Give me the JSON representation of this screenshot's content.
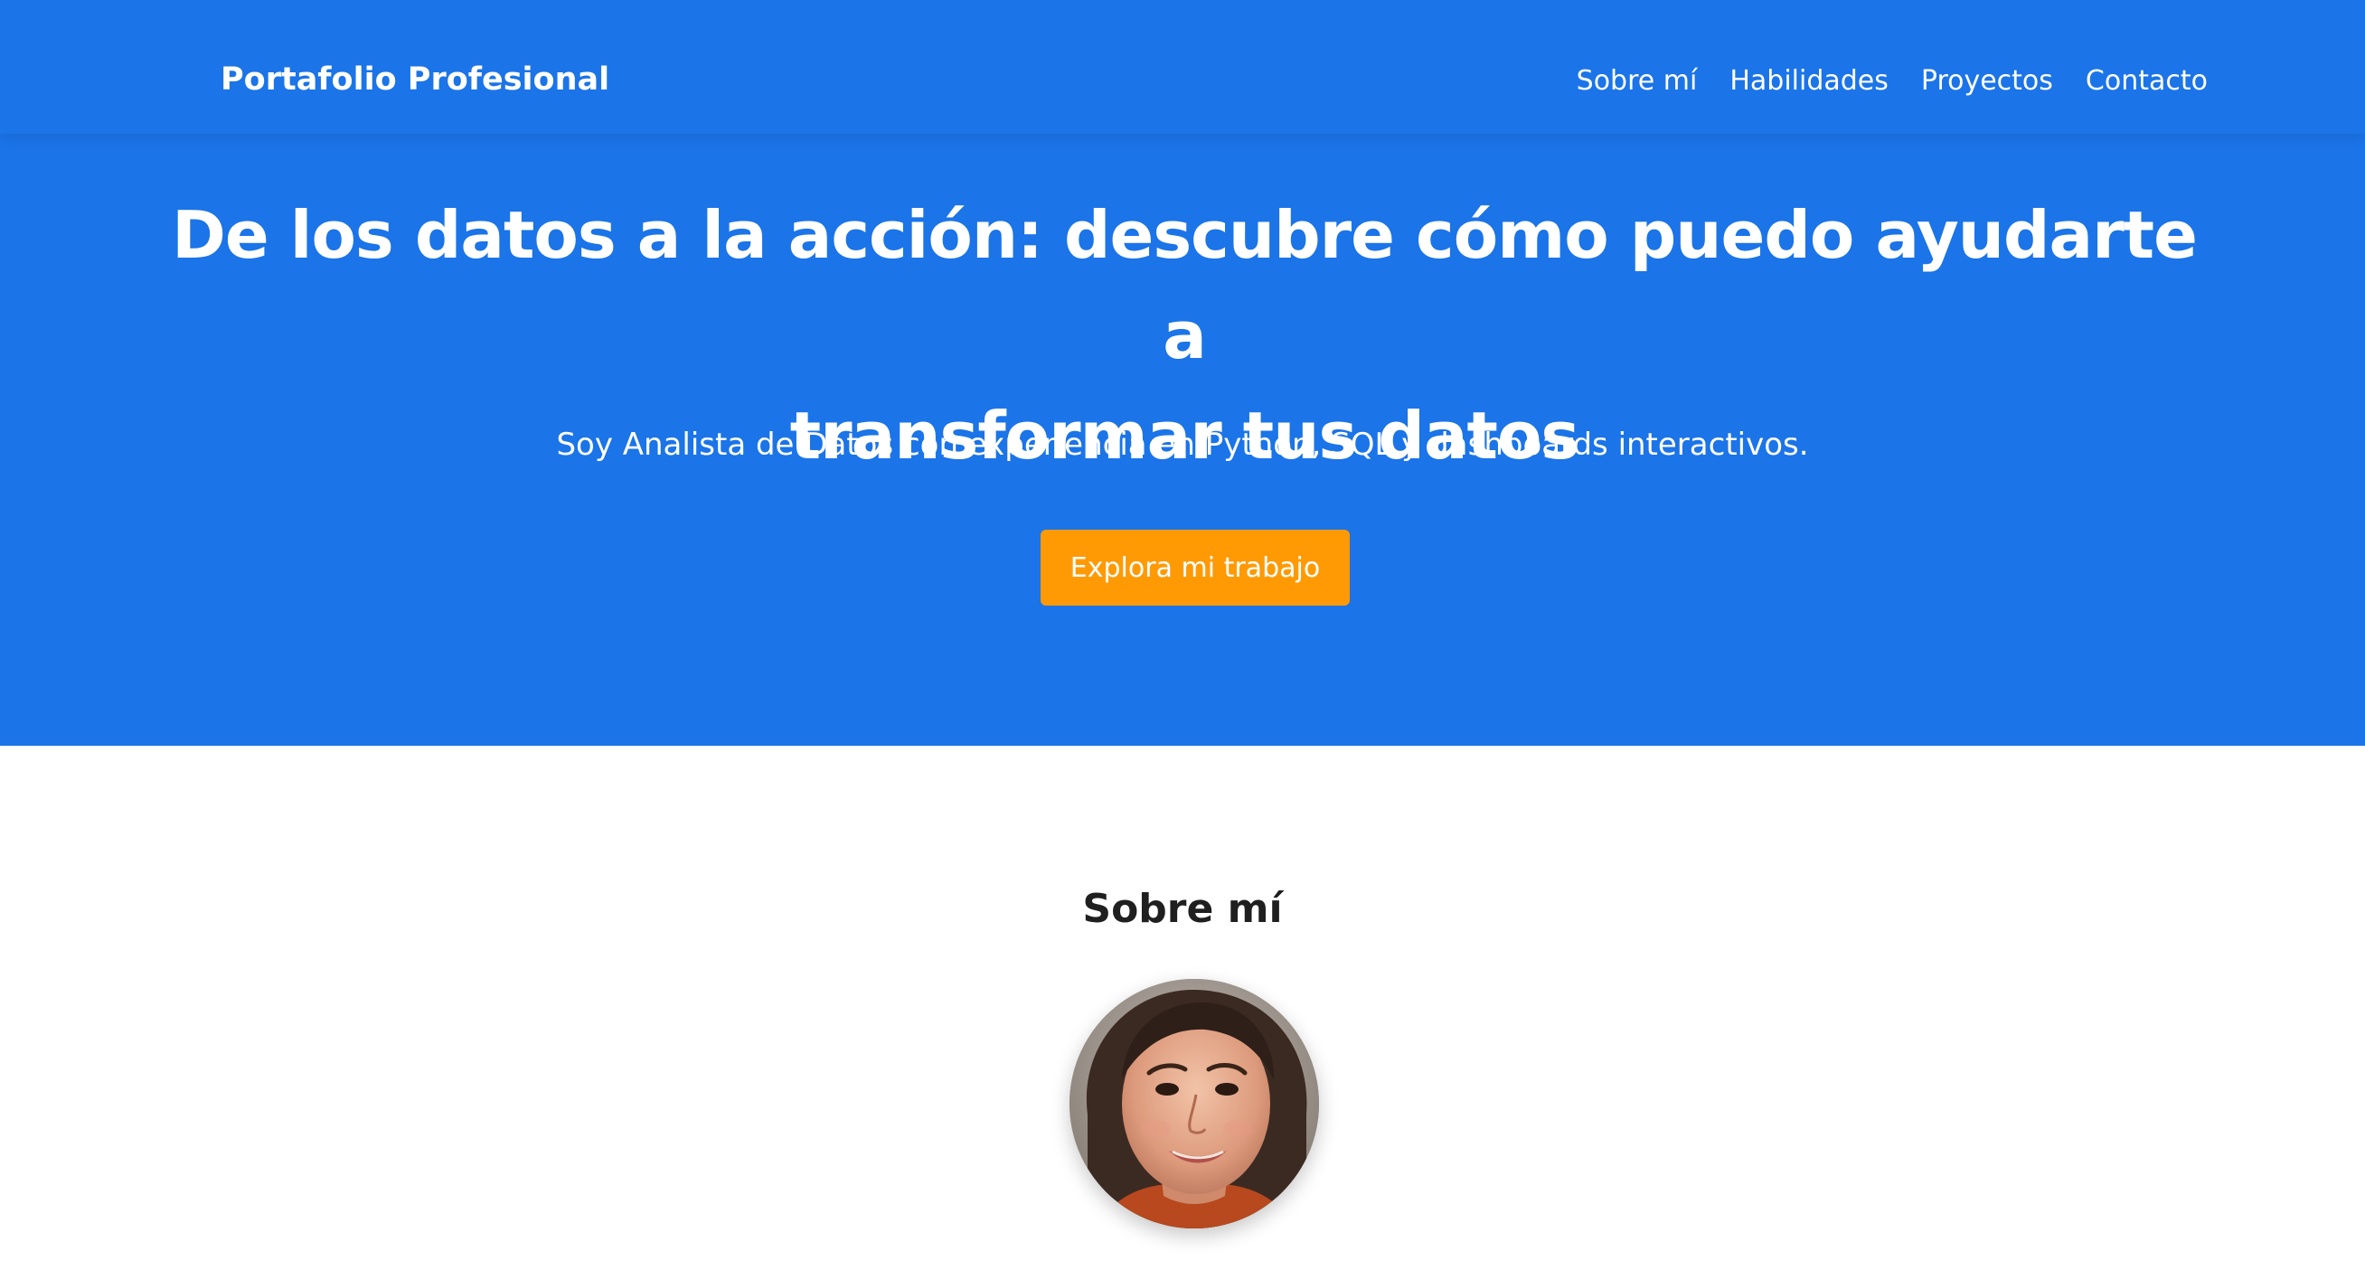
{
  "nav": {
    "brand": "Portafolio Profesional",
    "links": [
      "Sobre mí",
      "Habilidades",
      "Proyectos",
      "Contacto"
    ]
  },
  "hero": {
    "title_line1": "De los datos a la acción: descubre cómo puedo ayudarte a",
    "title_line2": "transformar tus datos",
    "subtitle": "Soy Analista de Datos con experiencia en Python, SQL y dashboards interactivos.",
    "cta_label": "Explora mi trabajo"
  },
  "about": {
    "title": "Sobre mí"
  },
  "colors": {
    "primary_blue": "#1b74e8",
    "cta_orange": "#ff9a05",
    "heading_dark": "#1f1f1f",
    "background": "#ffffff"
  }
}
